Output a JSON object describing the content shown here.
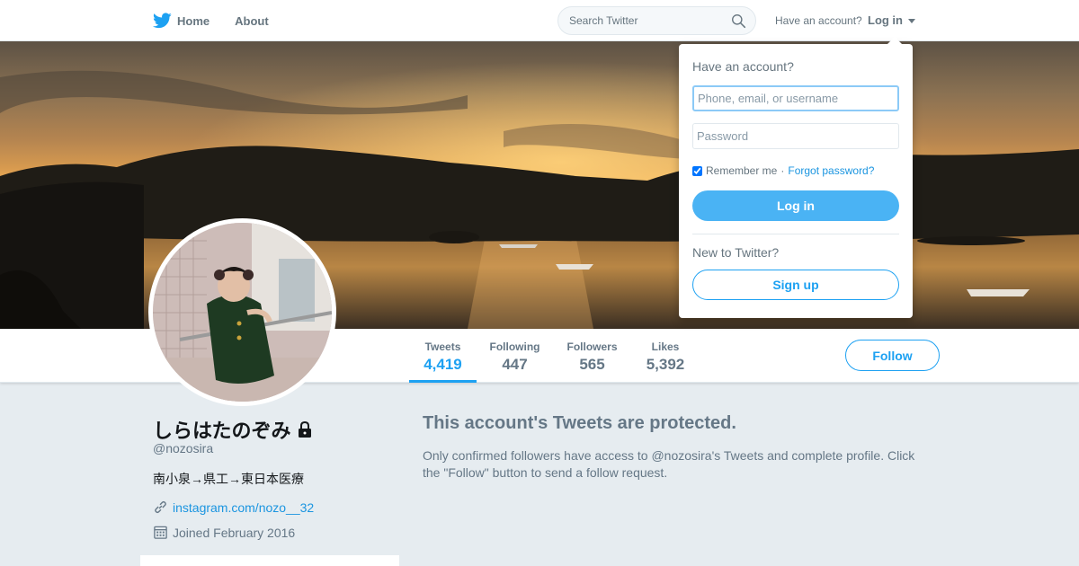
{
  "nav": {
    "home_label": "Home",
    "about_label": "About",
    "search_placeholder": "Search Twitter",
    "have_account": "Have an account?",
    "login_label": "Log in"
  },
  "login_dropdown": {
    "heading": "Have an account?",
    "username_placeholder": "Phone, email, or username",
    "password_placeholder": "Password",
    "remember_me": "Remember me",
    "separator": "·",
    "forgot_password": "Forgot password?",
    "login_button": "Log in",
    "new_to_twitter": "New to Twitter?",
    "signup_button": "Sign up"
  },
  "profile": {
    "display_name": "しらはたのぞみ",
    "screen_name": "@nozosira",
    "bio": "南小泉→県工→東日本医療",
    "website": "instagram.com/nozo__32",
    "joined": "Joined February 2016",
    "protected": true
  },
  "stats": [
    {
      "label": "Tweets",
      "value": "4,419",
      "active": true
    },
    {
      "label": "Following",
      "value": "447",
      "active": false
    },
    {
      "label": "Followers",
      "value": "565",
      "active": false
    },
    {
      "label": "Likes",
      "value": "5,392",
      "active": false
    }
  ],
  "follow_button": "Follow",
  "protected_notice": {
    "title": "This account's Tweets are protected.",
    "text": "Only confirmed followers have access to @nozosira's Tweets and complete profile. Click the \"Follow\" button to send a follow request."
  },
  "colors": {
    "accent": "#1da1f2",
    "background": "#e6ecf0",
    "muted_text": "#657786"
  },
  "icons": {
    "logo": "twitter-bird-icon",
    "search": "search-icon",
    "lock": "lock-icon",
    "link": "link-icon",
    "calendar": "calendar-icon"
  }
}
